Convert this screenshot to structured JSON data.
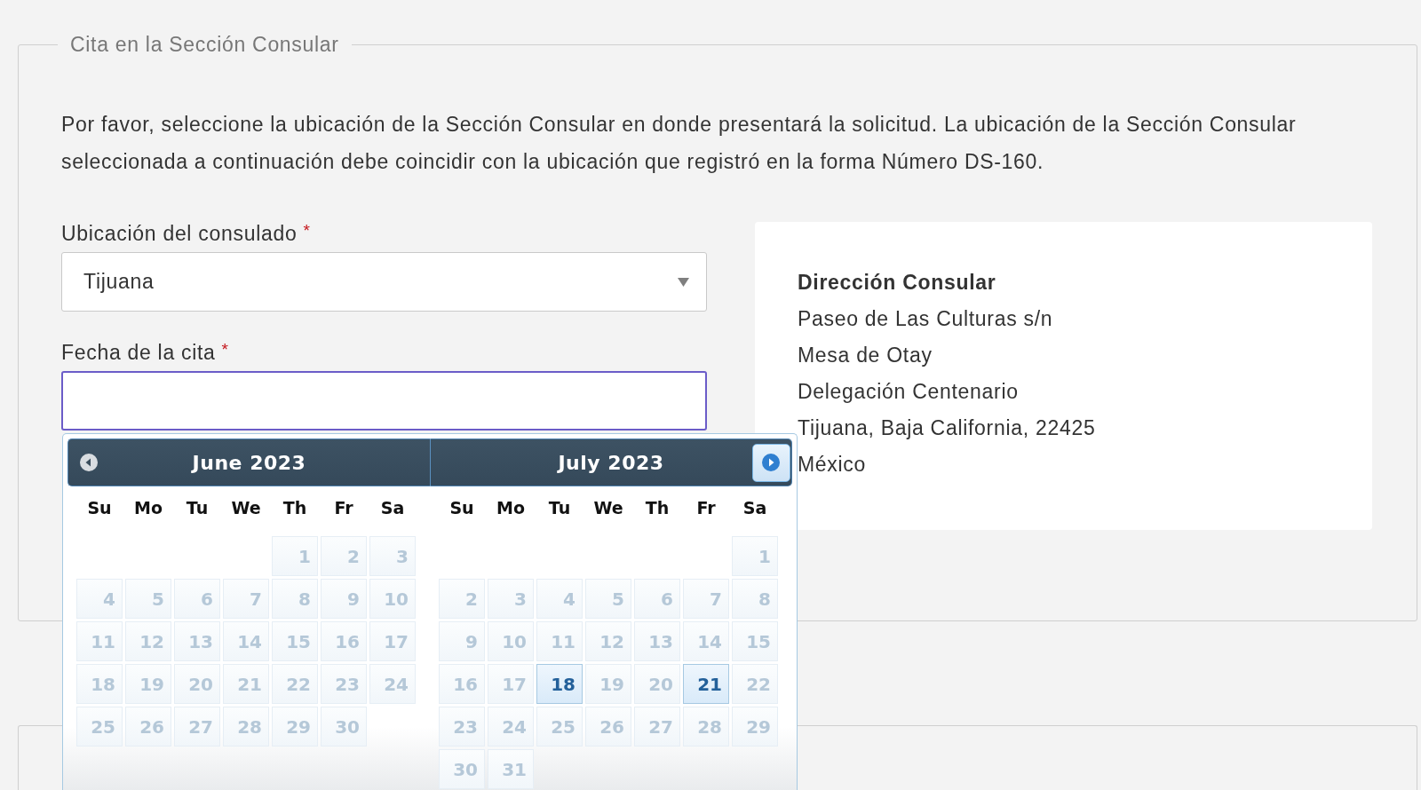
{
  "appointment_section": {
    "legend": "Cita en la Sección Consular",
    "instructions": "Por favor, seleccione la ubicación de la Sección Consular en donde presentará la solicitud. La ubicación de la Sección Consular seleccionada a continuación debe coincidir con la ubicación que registró en la forma Número DS-160.",
    "fields": [
      {
        "kind": "select",
        "label": "Ubicación del consulado",
        "required_mark": "*",
        "value": "Tijuana",
        "focused": false
      },
      {
        "kind": "date",
        "label": "Fecha de la cita",
        "required_mark": "*",
        "focused": true
      }
    ],
    "address": {
      "title": "Dirección Consular",
      "lines": [
        "Paseo de Las Culturas s/n",
        "Mesa de Otay",
        "Delegación Centenario",
        "Tijuana, Baja California, 22425",
        "México"
      ]
    }
  },
  "datepicker": {
    "prev_button": {
      "disabled": true
    },
    "next_button": {
      "disabled": false
    },
    "months": [
      {
        "title": "June 2023",
        "weekdays": [
          "Su",
          "Mo",
          "Tu",
          "We",
          "Th",
          "Fr",
          "Sa"
        ],
        "weeks": [
          {
            "days": [
              {
                "day": "1",
                "disabled": true
              },
              {
                "day": "2",
                "disabled": true
              },
              {
                "day": "3",
                "disabled": true
              }
            ]
          },
          {
            "days": [
              {
                "day": "4",
                "disabled": true
              },
              {
                "day": "5",
                "disabled": true
              },
              {
                "day": "6",
                "disabled": true
              },
              {
                "day": "7",
                "disabled": true
              },
              {
                "day": "8",
                "disabled": true
              },
              {
                "day": "9",
                "disabled": true
              },
              {
                "day": "10",
                "disabled": true
              }
            ]
          },
          {
            "days": [
              {
                "day": "11",
                "disabled": true
              },
              {
                "day": "12",
                "disabled": true
              },
              {
                "day": "13",
                "disabled": true
              },
              {
                "day": "14",
                "disabled": true
              },
              {
                "day": "15",
                "disabled": true
              },
              {
                "day": "16",
                "disabled": true
              },
              {
                "day": "17",
                "disabled": true
              }
            ]
          },
          {
            "days": [
              {
                "day": "18",
                "disabled": true
              },
              {
                "day": "19",
                "disabled": true
              },
              {
                "day": "20",
                "disabled": true
              },
              {
                "day": "21",
                "disabled": true
              },
              {
                "day": "22",
                "disabled": true
              },
              {
                "day": "23",
                "disabled": true
              },
              {
                "day": "24",
                "disabled": true
              }
            ]
          },
          {
            "days": [
              {
                "day": "25",
                "disabled": true
              },
              {
                "day": "26",
                "disabled": true
              },
              {
                "day": "27",
                "disabled": true
              },
              {
                "day": "28",
                "disabled": true
              },
              {
                "day": "29",
                "disabled": true
              },
              {
                "day": "30",
                "disabled": true
              }
            ]
          }
        ]
      },
      {
        "title": "July 2023",
        "weekdays": [
          "Su",
          "Mo",
          "Tu",
          "We",
          "Th",
          "Fr",
          "Sa"
        ],
        "weeks": [
          {
            "days": [
              {
                "day": "1",
                "disabled": true
              }
            ]
          },
          {
            "days": [
              {
                "day": "2",
                "disabled": true
              },
              {
                "day": "3",
                "disabled": true
              },
              {
                "day": "4",
                "disabled": true
              },
              {
                "day": "5",
                "disabled": true
              },
              {
                "day": "6",
                "disabled": true
              },
              {
                "day": "7",
                "disabled": true
              },
              {
                "day": "8",
                "disabled": true
              }
            ]
          },
          {
            "days": [
              {
                "day": "9",
                "disabled": true
              },
              {
                "day": "10",
                "disabled": true
              },
              {
                "day": "11",
                "disabled": true
              },
              {
                "day": "12",
                "disabled": true
              },
              {
                "day": "13",
                "disabled": true
              },
              {
                "day": "14",
                "disabled": true
              },
              {
                "day": "15",
                "disabled": true
              }
            ]
          },
          {
            "days": [
              {
                "day": "16",
                "disabled": true
              },
              {
                "day": "17",
                "disabled": true
              },
              {
                "day": "18",
                "disabled": false
              },
              {
                "day": "19",
                "disabled": true
              },
              {
                "day": "20",
                "disabled": true
              },
              {
                "day": "21",
                "disabled": false
              },
              {
                "day": "22",
                "disabled": true
              }
            ]
          },
          {
            "days": [
              {
                "day": "23",
                "disabled": true
              },
              {
                "day": "24",
                "disabled": true
              },
              {
                "day": "25",
                "disabled": true
              },
              {
                "day": "26",
                "disabled": true
              },
              {
                "day": "27",
                "disabled": true
              },
              {
                "day": "28",
                "disabled": true
              },
              {
                "day": "29",
                "disabled": true
              }
            ]
          },
          {
            "days": [
              {
                "day": "30",
                "disabled": true
              },
              {
                "day": "31",
                "disabled": true
              }
            ]
          }
        ]
      }
    ]
  }
}
